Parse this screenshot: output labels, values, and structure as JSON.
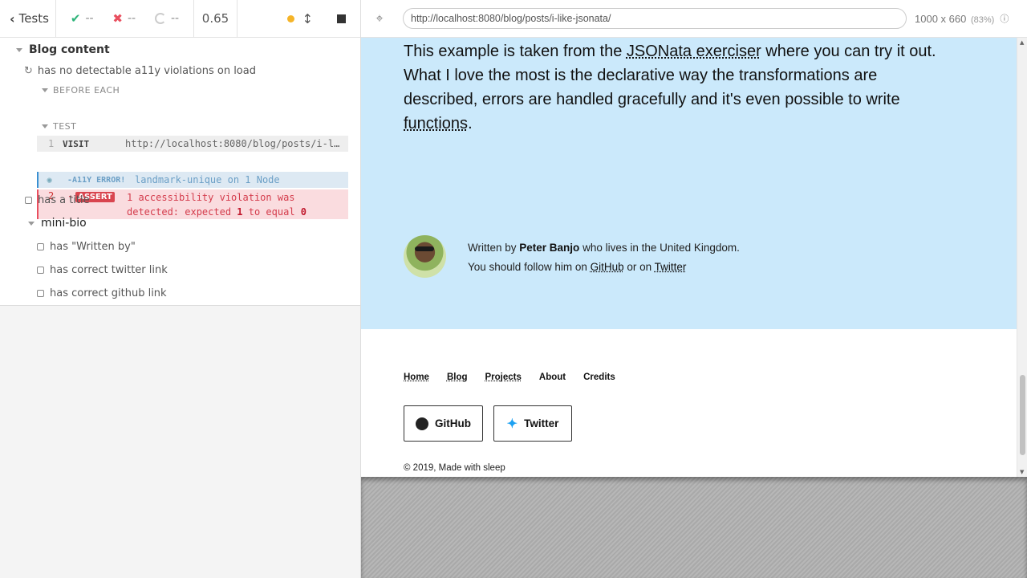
{
  "reporter": {
    "header": {
      "tests_label": "Tests",
      "passed": "--",
      "failed": "--",
      "pending": "--",
      "duration": "0.65"
    },
    "suite": {
      "title": "Blog content",
      "test_1": "has no detectable a11y violations on load",
      "before_each_label": "BEFORE EACH",
      "test_label": "TEST",
      "visit_cmd": {
        "number": "1",
        "name": "VISIT",
        "message": "http://localhost:8080/blog/posts/i-l…"
      },
      "a11y_cmd": {
        "number": "",
        "dash": "-",
        "name": "A11Y ERROR!",
        "message": "landmark-unique on 1 Node"
      },
      "assert_cmd": {
        "number": "2",
        "dash": "-",
        "name": "ASSERT",
        "message_1": "1 accessibility violation was",
        "message_2a": "detected: expected ",
        "expected": "1",
        "message_2b": " to equal ",
        "actual": "0"
      },
      "test_2": "has a title",
      "sub_suite": {
        "title": "mini-bio",
        "tests": [
          "has \"Written by\"",
          "has correct twitter link",
          "has correct github link"
        ]
      }
    }
  },
  "aut_header": {
    "url": "http://localhost:8080/blog/posts/i-like-jsonata/",
    "viewport": "1000 x 660",
    "scale": "(83%)"
  },
  "page": {
    "paragraph": {
      "part1": "This example is taken from the ",
      "link1": "JSONata exerciser",
      "part2": " where you can try it out. What I love the most is the declarative way the transformations are described, errors are handled gracefully and it's even possible to write ",
      "link2": "functions",
      "part3": "."
    },
    "author": {
      "written_by": "Written by ",
      "name": "Peter Banjo",
      "lives": " who lives in the United Kingdom.",
      "follow": "You should follow him on ",
      "github": "GitHub",
      "or_on": " or on ",
      "twitter": "Twitter"
    },
    "footer": {
      "nav": [
        "Home",
        "Blog",
        "Projects",
        "About",
        "Credits"
      ],
      "github_button": "GitHub",
      "twitter_button": "Twitter",
      "copyright": "© 2019, Made with sleep"
    }
  }
}
